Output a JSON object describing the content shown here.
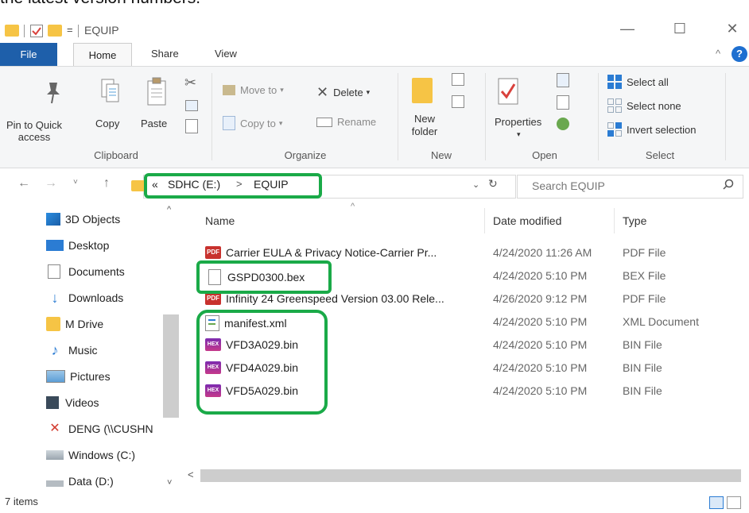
{
  "top_cut_text": "the latest version numbers.",
  "window": {
    "title": "EQUIP",
    "minimize_glyph": "—",
    "maximize_glyph": "☐",
    "close_glyph": "✕",
    "quick_access_sep": "="
  },
  "tabs": {
    "file": "File",
    "home": "Home",
    "share": "Share",
    "view": "View",
    "collapse": "^",
    "help": "?"
  },
  "ribbon": {
    "clipboard": {
      "pin_label": "Pin to Quick access",
      "copy_label": "Copy",
      "paste_label": "Paste",
      "group_label": "Clipboard"
    },
    "organize": {
      "move_to": "Move to",
      "copy_to": "Copy to",
      "delete": "Delete",
      "rename": "Rename",
      "group_label": "Organize"
    },
    "new": {
      "new_folder": "New folder",
      "group_label": "New"
    },
    "open": {
      "properties": "Properties",
      "group_label": "Open"
    },
    "select": {
      "select_all": "Select all",
      "select_none": "Select none",
      "invert_selection": "Invert selection",
      "group_label": "Select"
    }
  },
  "address": {
    "overflow": "«",
    "crumb1": "SDHC (E:)",
    "separator": ">",
    "crumb2": "EQUIP",
    "search_placeholder": "Search EQUIP"
  },
  "nav_pane": {
    "items": [
      {
        "label": "3D Objects",
        "icon": "3d-objects-icon"
      },
      {
        "label": "Desktop",
        "icon": "desktop-icon"
      },
      {
        "label": "Documents",
        "icon": "documents-icon"
      },
      {
        "label": "Downloads",
        "icon": "downloads-icon"
      },
      {
        "label": "M Drive",
        "icon": "folder-icon"
      },
      {
        "label": "Music",
        "icon": "music-icon"
      },
      {
        "label": "Pictures",
        "icon": "pictures-icon"
      },
      {
        "label": "Videos",
        "icon": "videos-icon"
      },
      {
        "label": "DENG (\\\\CUSHN",
        "icon": "network-drive-icon"
      },
      {
        "label": "Windows (C:)",
        "icon": "windows-drive-icon"
      },
      {
        "label": "Data (D:)",
        "icon": "drive-icon"
      }
    ]
  },
  "file_list": {
    "columns": {
      "name": "Name",
      "date": "Date modified",
      "type": "Type"
    },
    "files": [
      {
        "name": "Carrier EULA & Privacy Notice-Carrier Pr...",
        "date": "4/24/2020 11:26 AM",
        "type": "PDF File",
        "icon": "pdf-icon"
      },
      {
        "name": "GSPD0300.bex",
        "date": "4/24/2020 5:10 PM",
        "type": "BEX File",
        "icon": "document-icon"
      },
      {
        "name": "Infinity 24 Greenspeed Version 03.00 Rele...",
        "date": "4/26/2020 9:12 PM",
        "type": "PDF File",
        "icon": "pdf-icon"
      },
      {
        "name": "manifest.xml",
        "date": "4/24/2020 5:10 PM",
        "type": "XML Document",
        "icon": "xml-icon"
      },
      {
        "name": "VFD3A029.bin",
        "date": "4/24/2020 5:10 PM",
        "type": "BIN File",
        "icon": "hex-icon"
      },
      {
        "name": "VFD4A029.bin",
        "date": "4/24/2020 5:10 PM",
        "type": "BIN File",
        "icon": "hex-icon"
      },
      {
        "name": "VFD5A029.bin",
        "date": "4/24/2020 5:10 PM",
        "type": "BIN File",
        "icon": "hex-icon"
      }
    ]
  },
  "status": {
    "item_count": "7 items"
  },
  "colors": {
    "accent": "#1e5faa",
    "highlight": "#1aaa48",
    "pdf": "#c8322e",
    "folder": "#f6c445"
  }
}
